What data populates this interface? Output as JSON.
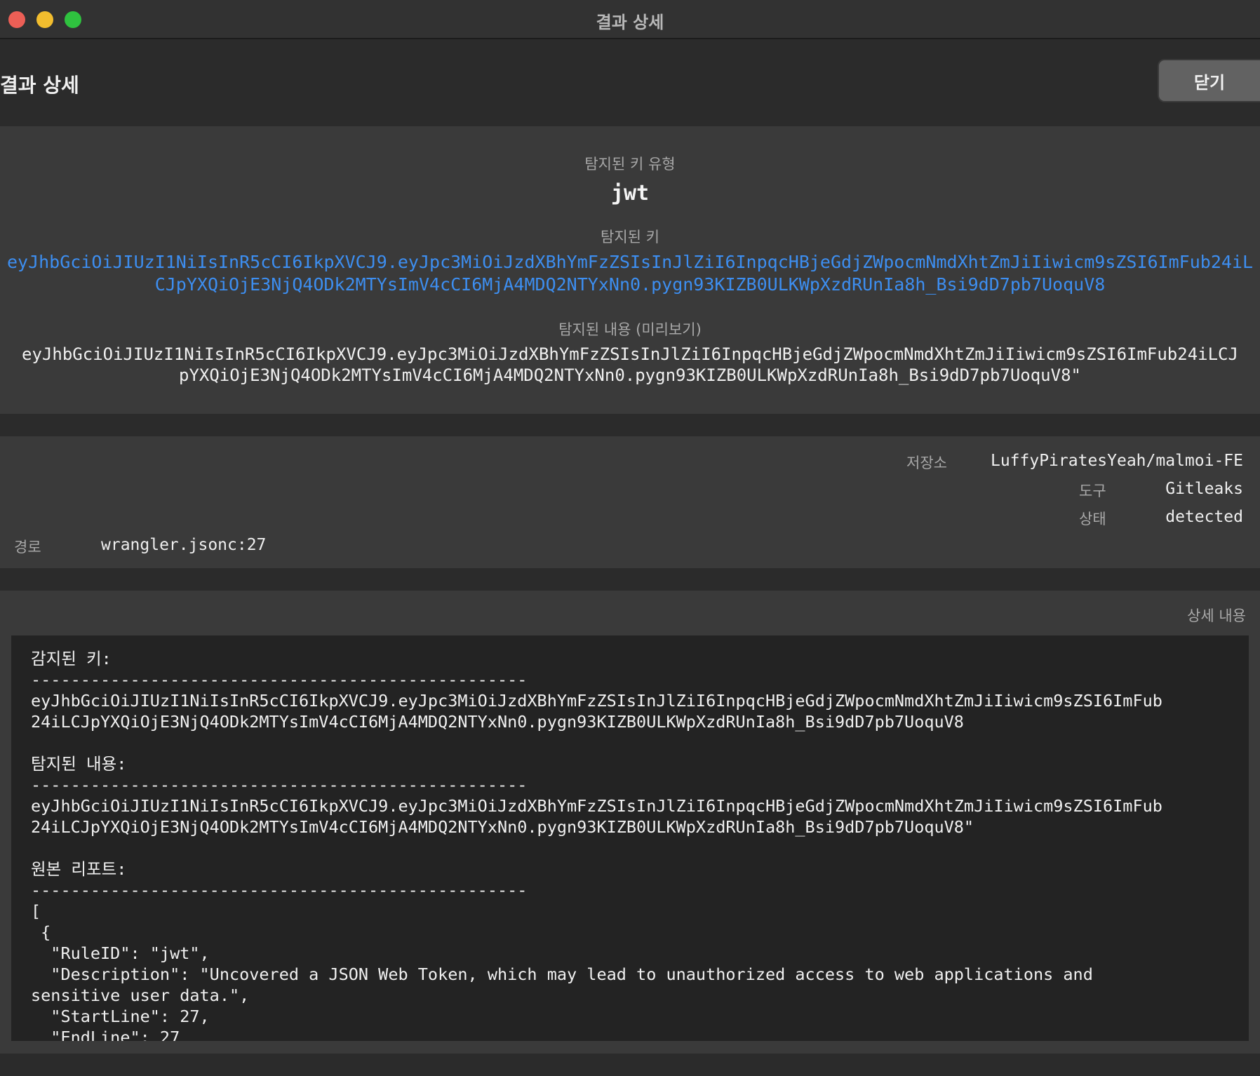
{
  "window": {
    "title": "결과 상세"
  },
  "header": {
    "title": "결과 상세",
    "close_label": "닫기"
  },
  "key_panel": {
    "key_type_label": "탐지된 키 유형",
    "key_type_value": "jwt",
    "key_label": "탐지된 키",
    "key_value": "eyJhbGciOiJIUzI1NiIsInR5cCI6IkpXVCJ9.eyJpc3MiOiJzdXBhYmFzZSIsInJlZiI6InpqcHBjeGdjZWpocmNmdXhtZmJiIiwicm9sZSI6ImFub24iLCJpYXQiOjE3NjQ4ODk2MTYsImV4cCI6MjA4MDQ2NTYxNn0.pygn93KIZB0ULKWpXzdRUnIa8h_Bsi9dD7pb7UoquV8",
    "preview_label": "탐지된 내용 (미리보기)",
    "preview_value": "eyJhbGciOiJIUzI1NiIsInR5cCI6IkpXVCJ9.eyJpc3MiOiJzdXBhYmFzZSIsInJlZiI6InpqcHBjeGdjZWpocmNmdXhtZmJiIiwicm9sZSI6ImFub24iLCJ\npYXQiOjE3NjQ4ODk2MTYsImV4cCI6MjA4MDQ2NTYxNn0.pygn93KIZB0ULKWpXzdRUnIa8h_Bsi9dD7pb7UoquV8\""
  },
  "meta": {
    "repo_label": "저장소",
    "repo_value": "LuffyPiratesYeah/malmoi-FE",
    "tool_label": "도구",
    "tool_value": "Gitleaks",
    "status_label": "상태",
    "status_value": "detected",
    "path_label": "경로",
    "path_value": "wrangler.jsonc:27"
  },
  "detail": {
    "heading": "상세 내용",
    "text": "감지된 키:\n--------------------------------------------------\neyJhbGciOiJIUzI1NiIsInR5cCI6IkpXVCJ9.eyJpc3MiOiJzdXBhYmFzZSIsInJlZiI6InpqcHBjeGdjZWpocmNmdXhtZmJiIiwicm9sZSI6ImFub\n24iLCJpYXQiOjE3NjQ4ODk2MTYsImV4cCI6MjA4MDQ2NTYxNn0.pygn93KIZB0ULKWpXzdRUnIa8h_Bsi9dD7pb7UoquV8\n\n탐지된 내용:\n--------------------------------------------------\neyJhbGciOiJIUzI1NiIsInR5cCI6IkpXVCJ9.eyJpc3MiOiJzdXBhYmFzZSIsInJlZiI6InpqcHBjeGdjZWpocmNmdXhtZmJiIiwicm9sZSI6ImFub\n24iLCJpYXQiOjE3NjQ4ODk2MTYsImV4cCI6MjA4MDQ2NTYxNn0.pygn93KIZB0ULKWpXzdRUnIa8h_Bsi9dD7pb7UoquV8\"\n\n원본 리포트:\n--------------------------------------------------\n[\n {\n  \"RuleID\": \"jwt\",\n  \"Description\": \"Uncovered a JSON Web Token, which may lead to unauthorized access to web applications and\nsensitive user data.\",\n  \"StartLine\": 27,\n  \"EndLine\": 27"
  }
}
